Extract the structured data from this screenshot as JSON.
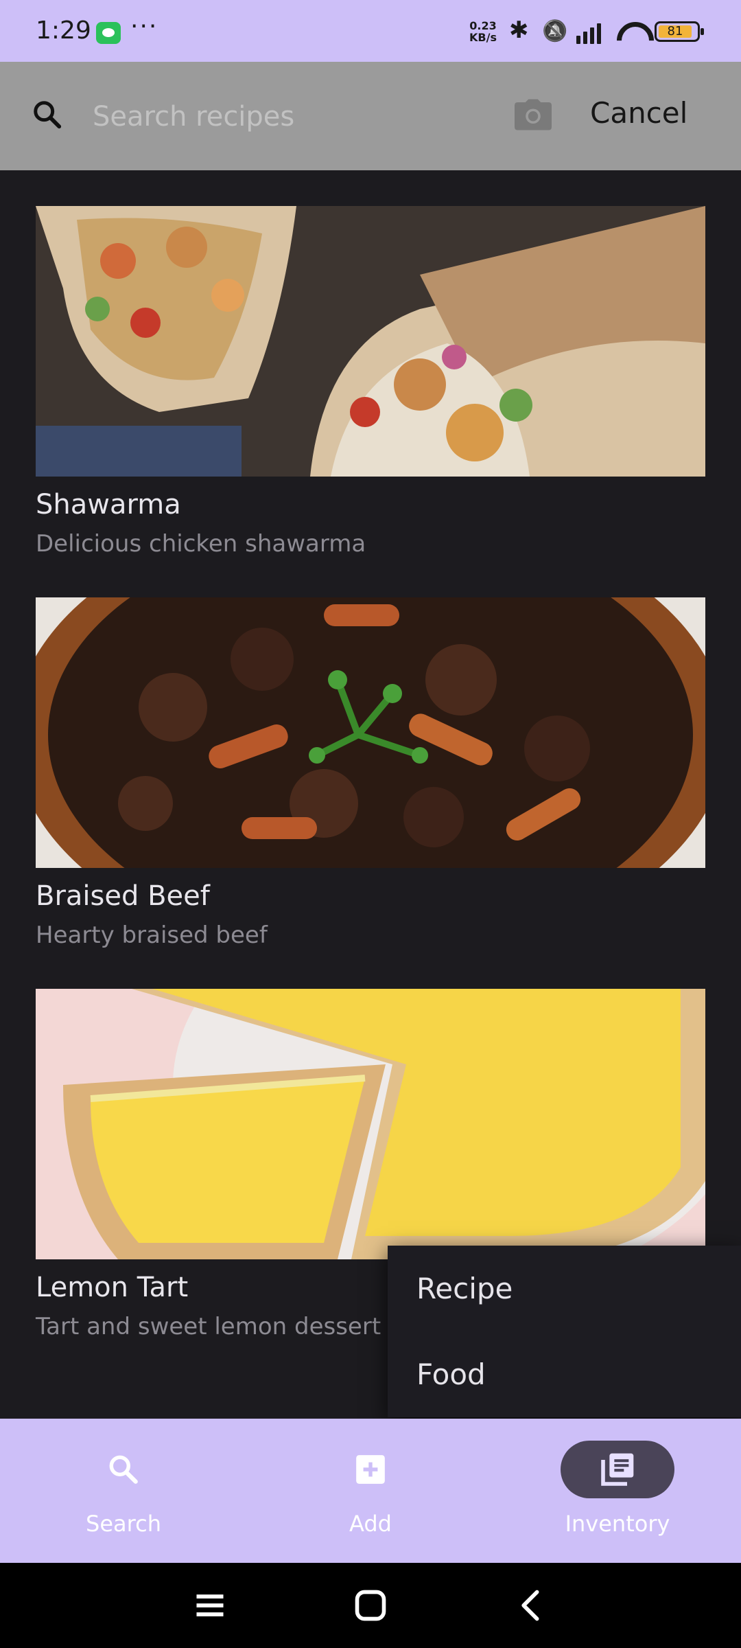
{
  "status_bar": {
    "time": "1:29",
    "dots": "···",
    "net_speed_value": "0.23",
    "net_speed_unit": "KB/s",
    "battery": "81"
  },
  "search": {
    "placeholder": "Search recipes",
    "cancel_label": "Cancel"
  },
  "recipes": [
    {
      "title": "Shawarma",
      "description": "Delicious chicken shawarma"
    },
    {
      "title": "Braised Beef",
      "description": "Hearty braised beef"
    },
    {
      "title": "Lemon Tart",
      "description": "Tart and sweet lemon dessert"
    }
  ],
  "menu": {
    "items": [
      {
        "label": "Recipe"
      },
      {
        "label": "Food"
      }
    ]
  },
  "bottom_nav": {
    "items": [
      {
        "label": "Search",
        "icon": "search-icon"
      },
      {
        "label": "Add",
        "icon": "add-box-icon"
      },
      {
        "label": "Inventory",
        "icon": "library-books-icon",
        "active": true
      }
    ]
  },
  "colors": {
    "accent": "#cdbff8",
    "background": "#1c1b1f",
    "active_pill": "#4a4458"
  }
}
